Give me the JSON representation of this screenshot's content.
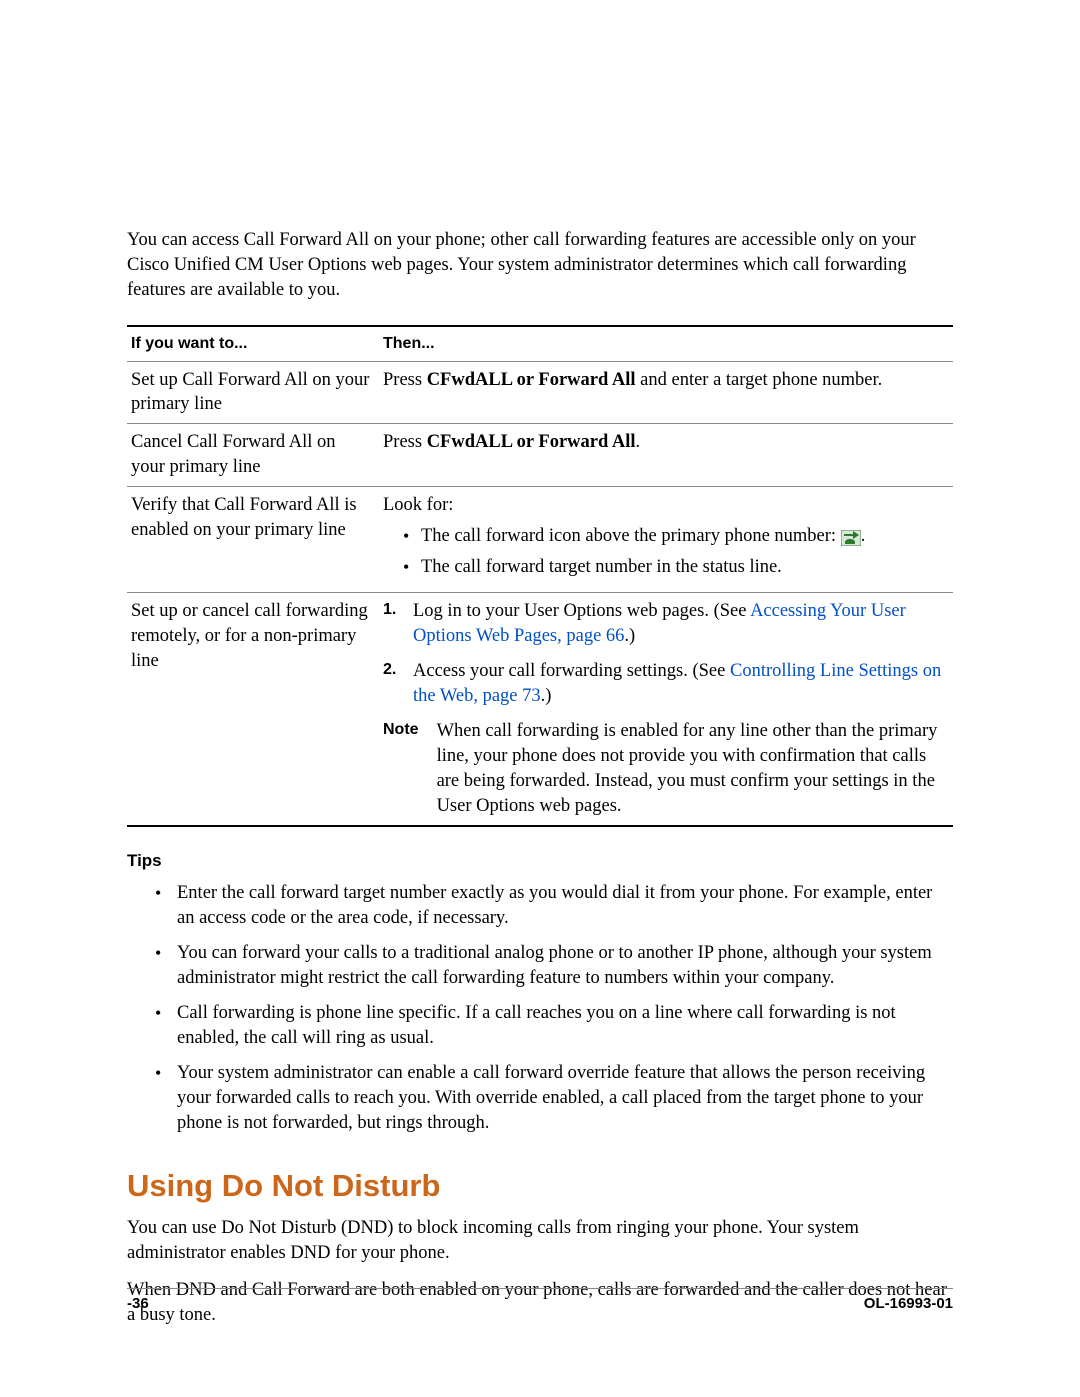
{
  "intro": "You can access Call Forward All on your phone; other call forwarding features are accessible only on your Cisco Unified CM User Options web pages. Your system administrator determines which call forwarding features are available to you.",
  "table": {
    "headers": {
      "left": "If you want to...",
      "right": "Then..."
    },
    "rows": {
      "r1": {
        "left": "Set up Call Forward All on your primary line",
        "press": "Press ",
        "bold": "CFwdALL or Forward All",
        "rest": " and enter a target phone number."
      },
      "r2": {
        "left": "Cancel Call Forward All on your primary line",
        "press": "Press ",
        "bold": "CFwdALL or Forward All",
        "rest": "."
      },
      "r3": {
        "left": "Verify that Call Forward All is enabled on your primary line",
        "look": "Look for:",
        "b1a": "The call forward icon above the primary phone number: ",
        "b1b": ".",
        "b2": "The call forward target number in the status line."
      },
      "r4": {
        "left": "Set up or cancel call forwarding remotely, or for a non-primary line",
        "step1a": "Log in to your User Options web pages. (See ",
        "step1link": "Accessing Your User Options Web Pages, page 66",
        "step1b": ".)",
        "step2a": "Access your call forwarding settings. (See ",
        "step2link": "Controlling Line Settings on the Web, page 73",
        "step2b": ".)",
        "note_label": "Note",
        "note_body": "When call forwarding is enabled for any line other than the primary line, your phone does not provide you with confirmation that calls are being forwarded. Instead, you must confirm your settings in the User Options web pages."
      }
    }
  },
  "tips": {
    "heading": "Tips",
    "items": [
      "Enter the call forward target number exactly as you would dial it from your phone. For example, enter an access code or the area code, if necessary.",
      "You can forward your calls to a traditional analog phone or to another IP phone, although your system administrator might restrict the call forwarding feature to numbers within your company.",
      "Call forwarding is phone line specific. If a call reaches you on a line where call forwarding is not enabled, the call will ring as usual.",
      "Your system administrator can enable a call forward override feature that allows the person receiving your forwarded calls to reach you. With override enabled, a call placed from the target phone to your phone is not forwarded, but rings through."
    ]
  },
  "section2": {
    "heading": "Using Do Not Disturb",
    "p1": "You can use Do Not Disturb (DND) to block incoming calls from ringing your phone. Your system administrator enables DND for your phone.",
    "p2": "When DND and Call Forward are both enabled on your phone, calls are forwarded and the caller does not hear a busy tone."
  },
  "footer": {
    "page": "-36",
    "docid": "OL-16993-01"
  }
}
